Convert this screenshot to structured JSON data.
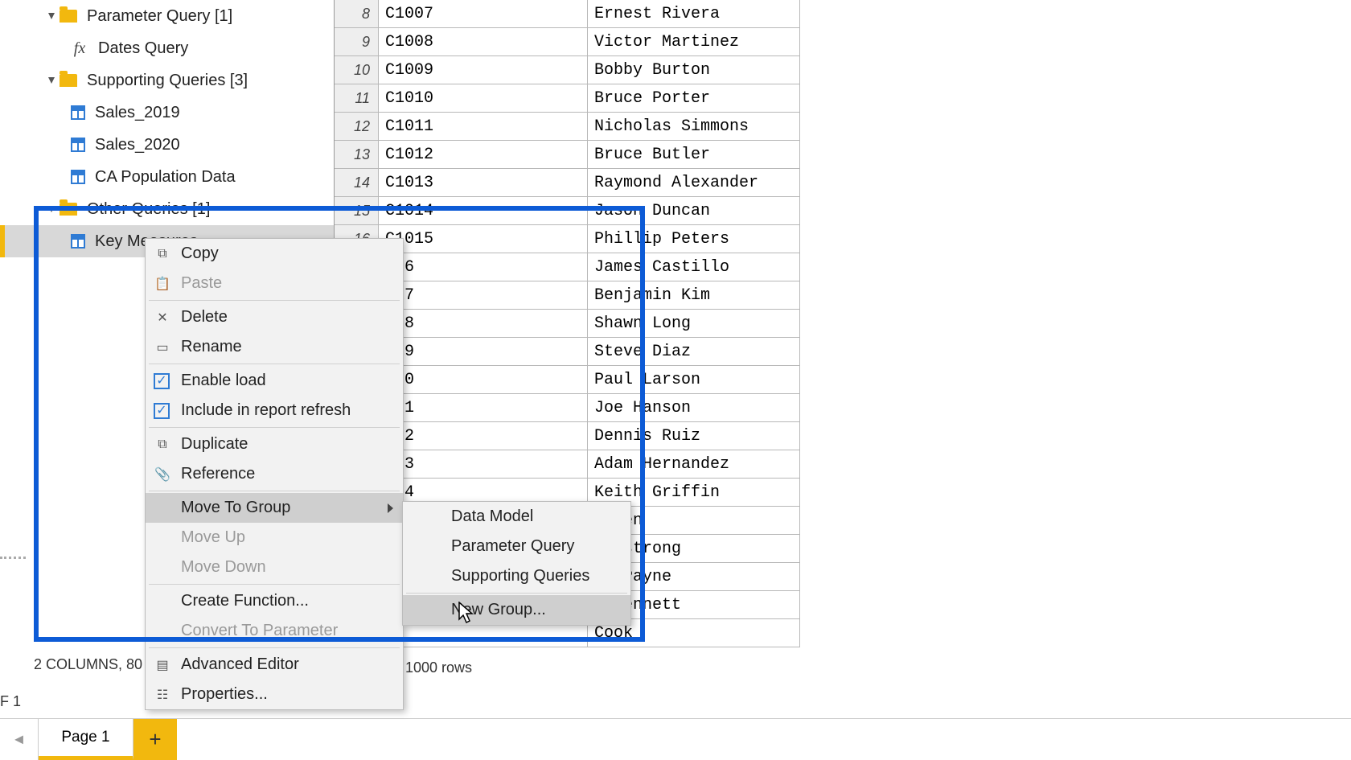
{
  "tree": {
    "parameterQuery": "Parameter Query [1]",
    "datesQuery": "Dates Query",
    "supportingQueries": "Supporting Queries [3]",
    "sales2019": "Sales_2019",
    "sales2020": "Sales_2020",
    "caPop": "CA Population Data",
    "otherQueries": "Other Queries [1]",
    "keyMeasures": "Key Measures"
  },
  "grid": [
    {
      "n": "8",
      "id": "C1007",
      "name": "Ernest Rivera"
    },
    {
      "n": "9",
      "id": "C1008",
      "name": "Victor Martinez"
    },
    {
      "n": "10",
      "id": "C1009",
      "name": "Bobby Burton"
    },
    {
      "n": "11",
      "id": "C1010",
      "name": "Bruce Porter"
    },
    {
      "n": "12",
      "id": "C1011",
      "name": "Nicholas Simmons"
    },
    {
      "n": "13",
      "id": "C1012",
      "name": "Bruce Butler"
    },
    {
      "n": "14",
      "id": "C1013",
      "name": "Raymond Alexander"
    },
    {
      "n": "15",
      "id": "C1014",
      "name": "Jason Duncan"
    },
    {
      "n": "16",
      "id": "C1015",
      "name": "Phillip Peters"
    },
    {
      "n": "",
      "id": "016",
      "name": "James Castillo"
    },
    {
      "n": "",
      "id": "017",
      "name": "Benjamin Kim"
    },
    {
      "n": "",
      "id": "018",
      "name": "Shawn Long"
    },
    {
      "n": "",
      "id": "019",
      "name": "Steve Diaz"
    },
    {
      "n": "",
      "id": "020",
      "name": "Paul Larson"
    },
    {
      "n": "",
      "id": "021",
      "name": "Joe Hanson"
    },
    {
      "n": "",
      "id": "022",
      "name": "Dennis Ruiz"
    },
    {
      "n": "",
      "id": "023",
      "name": "Adam Hernandez"
    },
    {
      "n": "",
      "id": "024",
      "name": "Keith Griffin"
    },
    {
      "n": "",
      "id": "",
      "name": "Green"
    },
    {
      "n": "",
      "id": "",
      "name": "Armstrong"
    },
    {
      "n": "",
      "id": "",
      "name": "en Payne"
    },
    {
      "n": "",
      "id": "",
      "name": "a Bennett"
    },
    {
      "n": "",
      "id": "",
      "name": "Cook"
    }
  ],
  "contextMenu": {
    "copy": "Copy",
    "paste": "Paste",
    "delete": "Delete",
    "rename": "Rename",
    "enableLoad": "Enable load",
    "includeRefresh": "Include in report refresh",
    "duplicate": "Duplicate",
    "reference": "Reference",
    "moveToGroup": "Move To Group",
    "moveUp": "Move Up",
    "moveDown": "Move Down",
    "createFunction": "Create Function...",
    "convertToParameter": "Convert To Parameter",
    "advancedEditor": "Advanced Editor",
    "properties": "Properties..."
  },
  "submenu": {
    "dataModel": "Data Model",
    "parameterQuery": "Parameter Query",
    "supportingQueries": "Supporting Queries",
    "newGroup": "New Group..."
  },
  "status": {
    "left": "2 COLUMNS, 80",
    "right": "1000 rows",
    "f": "F 1"
  },
  "pageTab": "Page 1"
}
